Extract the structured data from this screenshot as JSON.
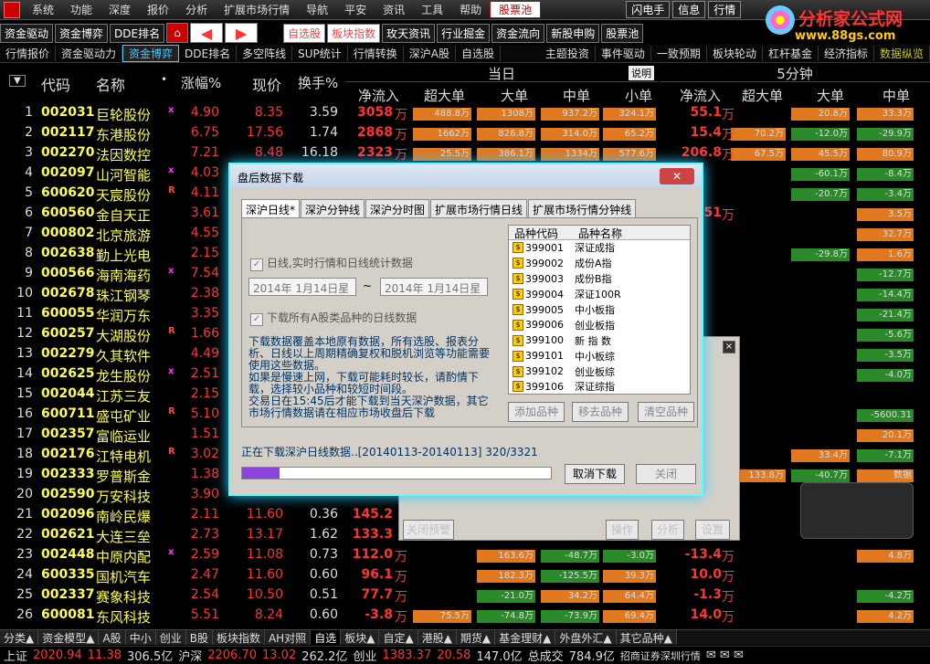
{
  "menubar": {
    "items": [
      "系统",
      "功能",
      "深度",
      "报价",
      "分析",
      "扩展市场行情",
      "导航",
      "平安",
      "资讯",
      "工具",
      "帮助"
    ],
    "pool": "股票池",
    "right": [
      "闪电手",
      "信息",
      "行情"
    ]
  },
  "brand": {
    "name": "分析家公式网",
    "url": "www.88gs.com"
  },
  "toolbar1": [
    "资金驱动",
    "资金博弈",
    "DDE排名",
    "自选股",
    "板块指数",
    "玫天资讯",
    "行业掘金",
    "资金流向",
    "新股申购",
    "股票池"
  ],
  "toolbar2": [
    "行情报价",
    "资金驱动力",
    "资金博弈",
    "DDE排名",
    "多空阵线",
    "SUP统计",
    "行情转换",
    "深沪A股",
    "自选股",
    "主题投资",
    "事件驱动",
    "一致预期",
    "板块轮动",
    "杠杆基金",
    "经济指标",
    "数据纵览"
  ],
  "header": {
    "seq": "▼",
    "code": "代码",
    "name": "名称",
    "chg": "涨幅%",
    "price": "现价",
    "turnover": "换手%",
    "today": "当日",
    "explain": "说明",
    "five": "5分钟",
    "netin": "净流入",
    "xl": "超大单",
    "l": "大单",
    "m": "中单",
    "s": "小单",
    "netin5": "净流入",
    "xl5": "超大单",
    "l5": "大单",
    "m5": "中单"
  },
  "rows": [
    {
      "n": "1",
      "code": "002031",
      "name": "巨轮股份",
      "mk": "x",
      "chg": "4.90",
      "price": "8.35",
      "to": "3.59",
      "net": "3058",
      "u": "万",
      "b1": "488.8万",
      "b2": "1308万",
      "b3": "937.2万",
      "b4": "324.1万",
      "n5": "55.1",
      "b5": "",
      "b6": "20.8万",
      "b7": "33.3万"
    },
    {
      "n": "2",
      "code": "002117",
      "name": "东港股份",
      "mk": "",
      "chg": "6.75",
      "price": "17.56",
      "to": "1.74",
      "net": "2868",
      "u": "万",
      "b1": "1662万",
      "b2": "826.8万",
      "b3": "314.0万",
      "b4": "65.2万",
      "n5": "15.4",
      "b5": "70.2万",
      "b6": "-12.0万",
      "b7": "-29.9万"
    },
    {
      "n": "3",
      "code": "002270",
      "name": "法因数控",
      "mk": "",
      "chg": "7.21",
      "price": "8.48",
      "to": "16.18",
      "net": "2323",
      "u": "万",
      "b1": "25.5万",
      "b2": "386.1万",
      "b3": "1334万",
      "b4": "577.6万",
      "n5": "206.8",
      "b5": "67.5万",
      "b6": "45.5万",
      "b7": "80.9万"
    },
    {
      "n": "4",
      "code": "002097",
      "name": "山河智能",
      "mk": "x",
      "chg": "4.03",
      "price": "",
      "to": "",
      "net": "",
      "u": "",
      "b1": "",
      "b2": "",
      "b3": "",
      "b4": "",
      "n5": "",
      "b5": "",
      "b6": "-60.1万",
      "b7": "-8.4万"
    },
    {
      "n": "5",
      "code": "600620",
      "name": "天宸股份",
      "mk": "R",
      "chg": "4.11",
      "price": "",
      "to": "",
      "net": "",
      "u": "",
      "b1": "",
      "b2": "",
      "b3": "",
      "b4": "",
      "n5": "",
      "b5": "",
      "b6": "-20.7万",
      "b7": "-3.4万"
    },
    {
      "n": "6",
      "code": "600560",
      "name": "金自天正",
      "mk": "",
      "chg": "3.61",
      "price": "",
      "to": "",
      "net": "",
      "u": "",
      "b1": "",
      "b2": "",
      "b3": "",
      "b4": "",
      "n5": "51",
      "b5": "",
      "b6": "",
      "b7": "3.5万"
    },
    {
      "n": "7",
      "code": "000802",
      "name": "北京旅游",
      "mk": "",
      "chg": "4.55",
      "price": "",
      "to": "",
      "net": "",
      "u": "",
      "b1": "",
      "b2": "",
      "b3": "",
      "b4": "",
      "n5": "",
      "b5": "",
      "b6": "",
      "b7": "32.7万"
    },
    {
      "n": "8",
      "code": "002638",
      "name": "勤上光电",
      "mk": "",
      "chg": "2.15",
      "price": "",
      "to": "",
      "net": "",
      "u": "",
      "b1": "",
      "b2": "",
      "b3": "",
      "b4": "",
      "n5": "",
      "b5": "",
      "b6": "-29.8万",
      "b7": "1.6万"
    },
    {
      "n": "9",
      "code": "000566",
      "name": "海南海药",
      "mk": "x",
      "chg": "7.54",
      "price": "",
      "to": "",
      "net": "",
      "u": "",
      "b1": "",
      "b2": "",
      "b3": "",
      "b4": "",
      "n5": "",
      "b5": "",
      "b6": "",
      "b7": "-12.7万"
    },
    {
      "n": "10",
      "code": "002678",
      "name": "珠江钢琴",
      "mk": "",
      "chg": "2.38",
      "price": "",
      "to": "",
      "net": "",
      "u": "",
      "b1": "",
      "b2": "",
      "b3": "",
      "b4": "",
      "n5": "",
      "b5": "",
      "b6": "",
      "b7": "-14.4万"
    },
    {
      "n": "11",
      "code": "600055",
      "name": "华润万东",
      "mk": "",
      "chg": "3.35",
      "price": "",
      "to": "",
      "net": "",
      "u": "",
      "b1": "",
      "b2": "",
      "b3": "",
      "b4": "",
      "n5": "",
      "b5": "",
      "b6": "",
      "b7": "-21.4万"
    },
    {
      "n": "12",
      "code": "600257",
      "name": "大湖股份",
      "mk": "R",
      "chg": "1.66",
      "price": "",
      "to": "",
      "net": "",
      "u": "",
      "b1": "",
      "b2": "",
      "b3": "",
      "b4": "",
      "n5": "",
      "b5": "",
      "b6": "",
      "b7": "-5.6万"
    },
    {
      "n": "13",
      "code": "002279",
      "name": "久其软件",
      "mk": "",
      "chg": "4.49",
      "price": "",
      "to": "",
      "net": "",
      "u": "",
      "b1": "",
      "b2": "",
      "b3": "",
      "b4": "",
      "n5": "",
      "b5": "",
      "b6": "",
      "b7": "-3.5万"
    },
    {
      "n": "14",
      "code": "002625",
      "name": "龙生股份",
      "mk": "x",
      "chg": "2.51",
      "price": "",
      "to": "",
      "net": "",
      "u": "",
      "b1": "",
      "b2": "",
      "b3": "",
      "b4": "",
      "n5": "",
      "b5": "",
      "b6": "",
      "b7": "-4.0万"
    },
    {
      "n": "15",
      "code": "002044",
      "name": "江苏三友",
      "mk": "",
      "chg": "2.15",
      "price": "",
      "to": "",
      "net": "",
      "u": "",
      "b1": "",
      "b2": "",
      "b3": "",
      "b4": "",
      "n5": "",
      "b5": "",
      "b6": "",
      "b7": ""
    },
    {
      "n": "16",
      "code": "600711",
      "name": "盛屯矿业",
      "mk": "R",
      "chg": "5.10",
      "price": "",
      "to": "",
      "net": "",
      "u": "",
      "b1": "",
      "b2": "",
      "b3": "",
      "b4": "",
      "n5": "",
      "b5": "",
      "b6": "",
      "b7": "-5600.31"
    },
    {
      "n": "17",
      "code": "002357",
      "name": "富临运业",
      "mk": "",
      "chg": "1.51",
      "price": "",
      "to": "",
      "net": "",
      "u": "",
      "b1": "",
      "b2": "",
      "b3": "",
      "b4": "",
      "n5": "",
      "b5": "",
      "b6": "",
      "b7": "20.1万"
    },
    {
      "n": "18",
      "code": "002176",
      "name": "江特电机",
      "mk": "R",
      "chg": "3.02",
      "price": "",
      "to": "",
      "net": "",
      "u": "",
      "b1": "",
      "b2": "",
      "b3": "",
      "b4": "",
      "n5": "",
      "b5": "",
      "b6": "33.4万",
      "b7": "-7.1万"
    },
    {
      "n": "19",
      "code": "002333",
      "name": "罗普斯金",
      "mk": "",
      "chg": "1.38",
      "price": "",
      "to": "",
      "net": "",
      "u": "",
      "b1": "",
      "b2": "",
      "b3": "",
      "b4": "",
      "n5": "",
      "b5": "133.8万",
      "b6": "-40.7万",
      "b7": "数据"
    },
    {
      "n": "20",
      "code": "002590",
      "name": "万安科技",
      "mk": "",
      "chg": "3.90",
      "price": "",
      "to": "",
      "net": "",
      "u": "",
      "b1": "",
      "b2": "",
      "b3": "",
      "b4": "",
      "n5": "",
      "b5": "",
      "b6": "",
      "b7": ""
    },
    {
      "n": "21",
      "code": "002096",
      "name": "南岭民爆",
      "mk": "",
      "chg": "2.11",
      "price": "11.60",
      "to": "0.36",
      "net": "145.2",
      "u": "",
      "b1": "",
      "b2": "",
      "b3": "",
      "b4": "",
      "n5": "",
      "b5": "",
      "b6": "",
      "b7": ""
    },
    {
      "n": "22",
      "code": "002621",
      "name": "大连三垒",
      "mk": "",
      "chg": "2.73",
      "price": "13.17",
      "to": "1.62",
      "net": "133.3",
      "u": "",
      "b1": "",
      "b2": "",
      "b3": "",
      "b4": "",
      "n5": "",
      "b5": "",
      "b6": "",
      "b7": ""
    },
    {
      "n": "23",
      "code": "002448",
      "name": "中原内配",
      "mk": "x",
      "chg": "2.59",
      "price": "11.08",
      "to": "0.73",
      "net": "112.0",
      "u": "万",
      "b1": "",
      "b2": "163.6万",
      "b3": "-48.7万",
      "b4": "-3.0万",
      "n5": "-13.4",
      "b5": "",
      "b6": "",
      "b7": "4.8万"
    },
    {
      "n": "24",
      "code": "600335",
      "name": "国机汽车",
      "mk": "",
      "chg": "2.47",
      "price": "11.60",
      "to": "0.60",
      "net": "96.1",
      "u": "万",
      "b1": "",
      "b2": "182.3万",
      "b3": "-125.5万",
      "b4": "39.3万",
      "n5": "10.0",
      "b5": "",
      "b6": "",
      "b7": ""
    },
    {
      "n": "25",
      "code": "002337",
      "name": "赛象科技",
      "mk": "",
      "chg": "2.54",
      "price": "10.50",
      "to": "0.51",
      "net": "77.7",
      "u": "万",
      "b1": "",
      "b2": "-21.0万",
      "b3": "34.2万",
      "b4": "64.4万",
      "n5": "-1.3",
      "b5": "",
      "b6": "",
      "b7": "-4.2万"
    },
    {
      "n": "26",
      "code": "600081",
      "name": "东风科技",
      "mk": "",
      "chg": "5.51",
      "price": "8.24",
      "to": "0.60",
      "net": "-3.8",
      "u": "万",
      "b1": "75.5万",
      "b2": "-74.8万",
      "b3": "-73.9万",
      "b4": "69.4万",
      "n5": "14.0",
      "b5": "",
      "b6": "",
      "b7": "4.2万"
    }
  ],
  "bottom_tabs": [
    "分类▲",
    "资金模型▲",
    "A股",
    "中小",
    "创业",
    "B股",
    "板块指数",
    "AH对照",
    "自选",
    "板块▲",
    "自定▲",
    "港股▲",
    "期货▲",
    "基金理财▲",
    "外盘外汇▲",
    "其它品种▲"
  ],
  "status": {
    "sh_label": "上证",
    "sh_val": "2020.94",
    "sh_chg": "11.38",
    "sh_amt": "306.5亿",
    "hs_label": "沪深",
    "hs_val": "2206.70",
    "hs_chg": "13.02",
    "hs_amt": "262.2亿",
    "cy_label": "创业",
    "cy_val": "1383.37",
    "cy_chg": "20.58",
    "cy_amt": "147.0亿",
    "total_label": "总成交",
    "total_val": "784.9亿",
    "broker": "招商证券深圳行情"
  },
  "dialog": {
    "title": "盘后数据下载",
    "close": "✕",
    "tabs": [
      "深沪日线*",
      "深沪分钟线",
      "深沪分时图",
      "扩展市场行情日线",
      "扩展市场行情分钟线"
    ],
    "chk1": "日线,实时行情和日线统计数据",
    "date_from": "2014年 1月14日星",
    "tilde": "~",
    "date_to": "2014年 1月14日星",
    "chk2": "下载所有A股类品种的日线数据",
    "desc": "下载数据覆盖本地原有数据，所有选股、报表分析、日线以上周期精确复权和脱机浏览等功能需要使用这些数据。\n如果是慢速上网，下载可能耗时较长，请酌情下载，选择较小品种和较短时间段。\n交易日在15:45后才能下载到当天深沪数据，其它市场行情数据请在相应市场收盘后下载",
    "list_h1": "品种代码",
    "list_h2": "品种名称",
    "list": [
      [
        "399001",
        "深证成指"
      ],
      [
        "399002",
        "成份A指"
      ],
      [
        "399003",
        "成份B指"
      ],
      [
        "399004",
        "深证100R"
      ],
      [
        "399005",
        "中小板指"
      ],
      [
        "399006",
        "创业板指"
      ],
      [
        "399100",
        "新 指 数"
      ],
      [
        "399101",
        "中小板综"
      ],
      [
        "399102",
        "创业板综"
      ],
      [
        "399106",
        "深证综指"
      ]
    ],
    "add": "添加品种",
    "remove": "移去品种",
    "clear": "清空品种",
    "progress_text": "正在下载深沪日线数据..[20140113-20140113] 320/3321",
    "cancel": "取消下载",
    "closebtn": "关闭"
  },
  "win2": {
    "close_alert": "关闭预警",
    "op": "操作",
    "analyze": "分析",
    "settings": "设置",
    "x": "×"
  }
}
